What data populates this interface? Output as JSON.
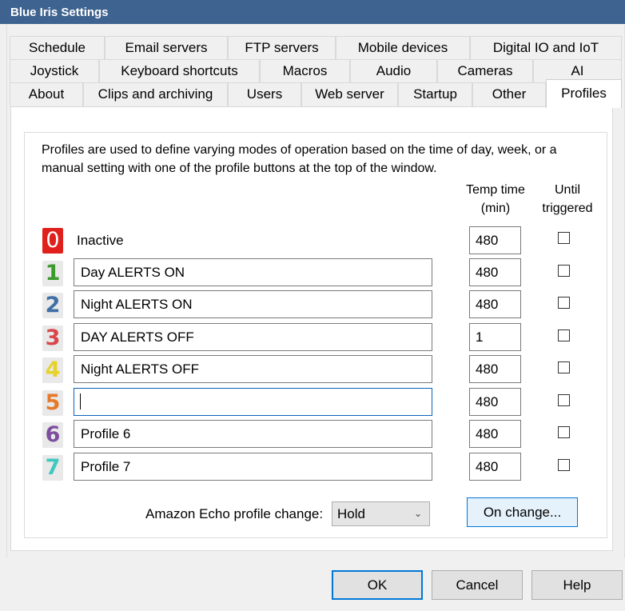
{
  "window": {
    "title": "Blue Iris Settings"
  },
  "tabs": {
    "row1": [
      "Schedule",
      "Email servers",
      "FTP servers",
      "Mobile devices",
      "Digital IO and IoT"
    ],
    "row2": [
      "Joystick",
      "Keyboard shortcuts",
      "Macros",
      "Audio",
      "Cameras",
      "AI"
    ],
    "row3": [
      "About",
      "Clips and archiving",
      "Users",
      "Web server",
      "Startup",
      "Other",
      "Profiles"
    ],
    "active": "Profiles"
  },
  "profiles_page": {
    "description": "Profiles are used to define varying modes of operation based on the time of day, week, or a manual setting with one of the profile buttons at the top of the window.",
    "col_temp_time": "Temp time (min)",
    "col_until_triggered": "Until triggered",
    "profiles": [
      {
        "number": "0",
        "name": "Inactive",
        "temp_time": "480",
        "until_triggered": false,
        "color": "#e0201c"
      },
      {
        "number": "1",
        "name": "Day ALERTS ON",
        "temp_time": "480",
        "until_triggered": false,
        "color": "#3c9a2e"
      },
      {
        "number": "2",
        "name": "Night ALERTS ON",
        "temp_time": "480",
        "until_triggered": false,
        "color": "#3f6fa6"
      },
      {
        "number": "3",
        "name": "DAY ALERTS OFF",
        "temp_time": "1",
        "until_triggered": false,
        "color": "#d8474a"
      },
      {
        "number": "4",
        "name": "Night ALERTS OFF",
        "temp_time": "480",
        "until_triggered": false,
        "color": "#e6d22a"
      },
      {
        "number": "5",
        "name": "",
        "temp_time": "480",
        "until_triggered": false,
        "color": "#e57a2c"
      },
      {
        "number": "6",
        "name": "Profile 6",
        "temp_time": "480",
        "until_triggered": false,
        "color": "#7e4f9e"
      },
      {
        "number": "7",
        "name": "Profile 7",
        "temp_time": "480",
        "until_triggered": false,
        "color": "#3ec9c0"
      }
    ],
    "echo_label": "Amazon Echo profile change:",
    "echo_value": "Hold",
    "on_change_button": "On change..."
  },
  "footer": {
    "ok": "OK",
    "cancel": "Cancel",
    "help": "Help"
  }
}
